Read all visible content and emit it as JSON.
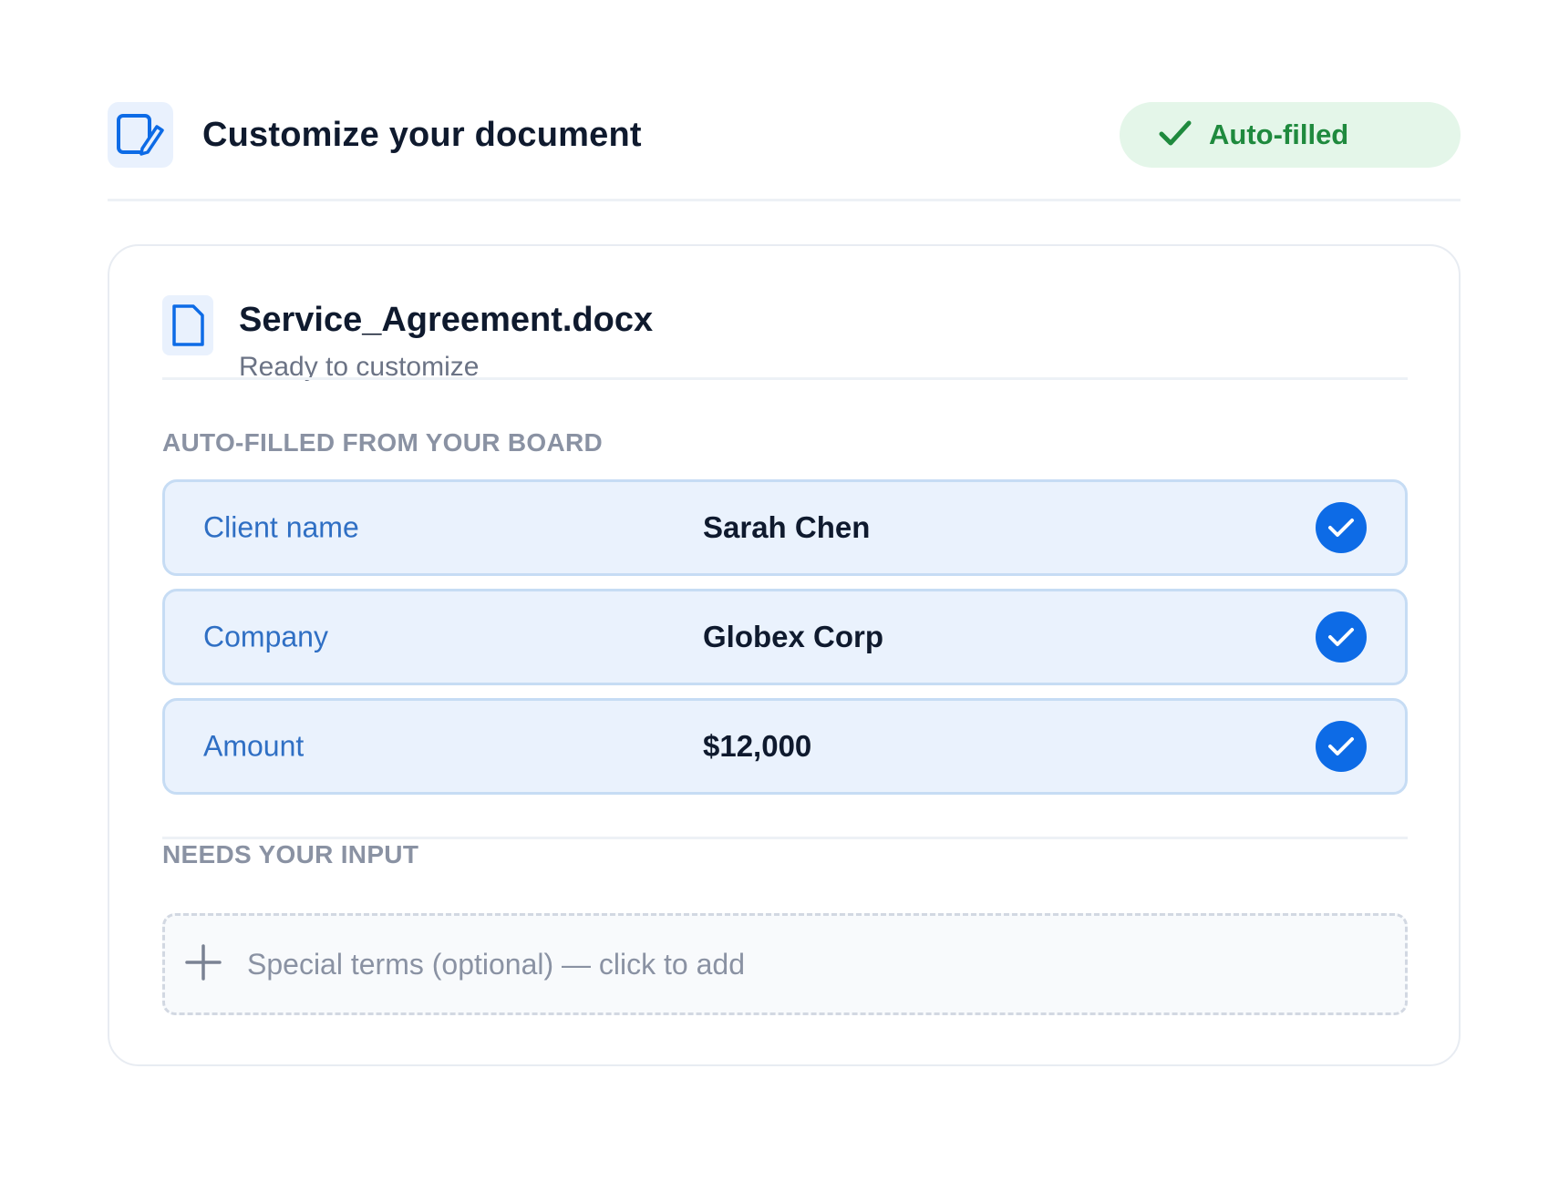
{
  "header": {
    "title": "Customize your document",
    "icon": "edit-document-icon",
    "badge": {
      "label": "Auto-filled",
      "icon": "check-icon",
      "color": "#1f8a3e"
    }
  },
  "document": {
    "file_name": "Service_Agreement.docx",
    "status": "Ready to customize",
    "icon": "file-icon"
  },
  "auto_filled": {
    "section_label": "AUTO-FILLED FROM YOUR BOARD",
    "fields": [
      {
        "label": "Client name",
        "value": "Sarah Chen"
      },
      {
        "label": "Company",
        "value": "Globex Corp"
      },
      {
        "label": "Amount",
        "value": "$12,000"
      }
    ]
  },
  "needs_input": {
    "section_label": "NEEDS YOUR INPUT",
    "add_label": "Special terms (optional) — click to add",
    "icon": "plus-icon"
  },
  "colors": {
    "accent": "#0d6be6",
    "success": "#1f8a3e",
    "field_bg": "#eaf2fd"
  }
}
